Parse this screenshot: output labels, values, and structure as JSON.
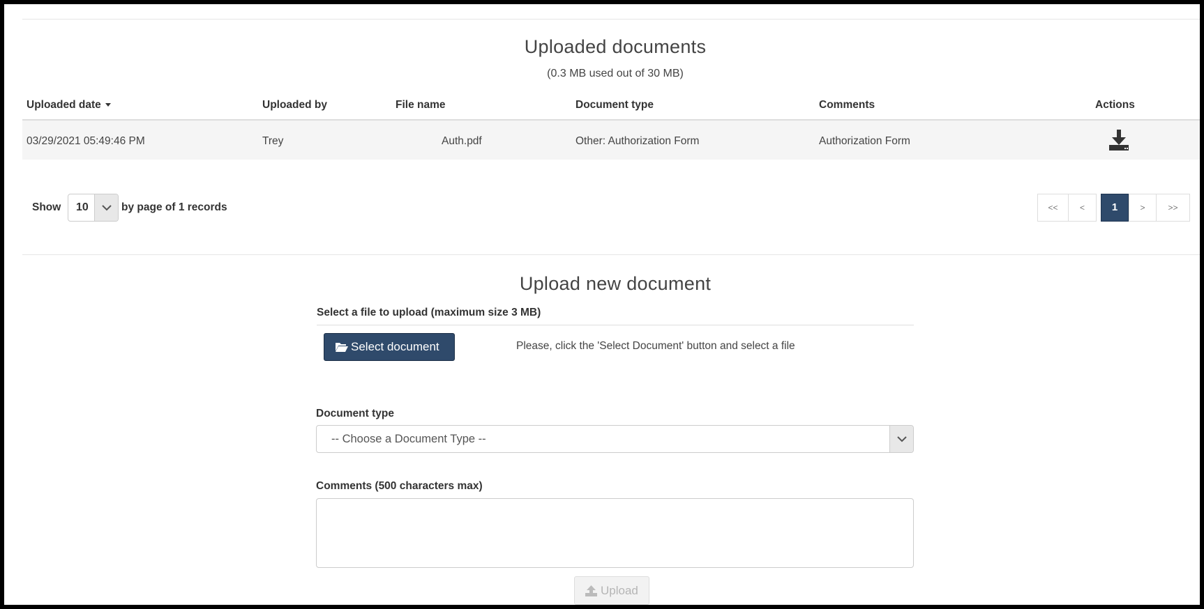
{
  "uploaded_section": {
    "title": "Uploaded documents",
    "usage": "(0.3 MB used out of 30 MB)"
  },
  "table": {
    "columns": [
      {
        "key": "date",
        "label": "Uploaded date",
        "sorted": "desc"
      },
      {
        "key": "by",
        "label": "Uploaded by"
      },
      {
        "key": "file",
        "label": "File name"
      },
      {
        "key": "type",
        "label": "Document type"
      },
      {
        "key": "comments",
        "label": "Comments"
      },
      {
        "key": "actions",
        "label": "Actions"
      }
    ],
    "rows": [
      {
        "date": "03/29/2021 05:49:46 PM",
        "by": "Trey",
        "file": "Auth.pdf",
        "type": "Other: Authorization Form",
        "comments": "Authorization Form",
        "action_icon": "download-icon"
      }
    ]
  },
  "paging": {
    "show_label": "Show",
    "page_size": "10",
    "records_prefix": "by page of ",
    "records_count": "1",
    "records_suffix": " records",
    "buttons": {
      "first": "<<",
      "prev": "<",
      "current": "1",
      "next": ">",
      "last": ">>"
    }
  },
  "upload_section": {
    "title": "Upload new document",
    "file_label": "Select a file to upload (maximum size 3 MB)",
    "select_button": "Select document",
    "select_icon": "folder-open-icon",
    "hint": "Please, click the 'Select Document' button and select a file",
    "doc_type_label": "Document type",
    "doc_type_placeholder": "-- Choose a Document Type --",
    "comments_label": "Comments (500 characters max)",
    "comments_value": "",
    "upload_button": "Upload",
    "upload_icon": "upload-icon"
  },
  "colors": {
    "primary": "#2f4a6b",
    "row_bg": "#f5f5f5",
    "border": "#cccccc",
    "disabled_text": "#b5b5b5"
  }
}
